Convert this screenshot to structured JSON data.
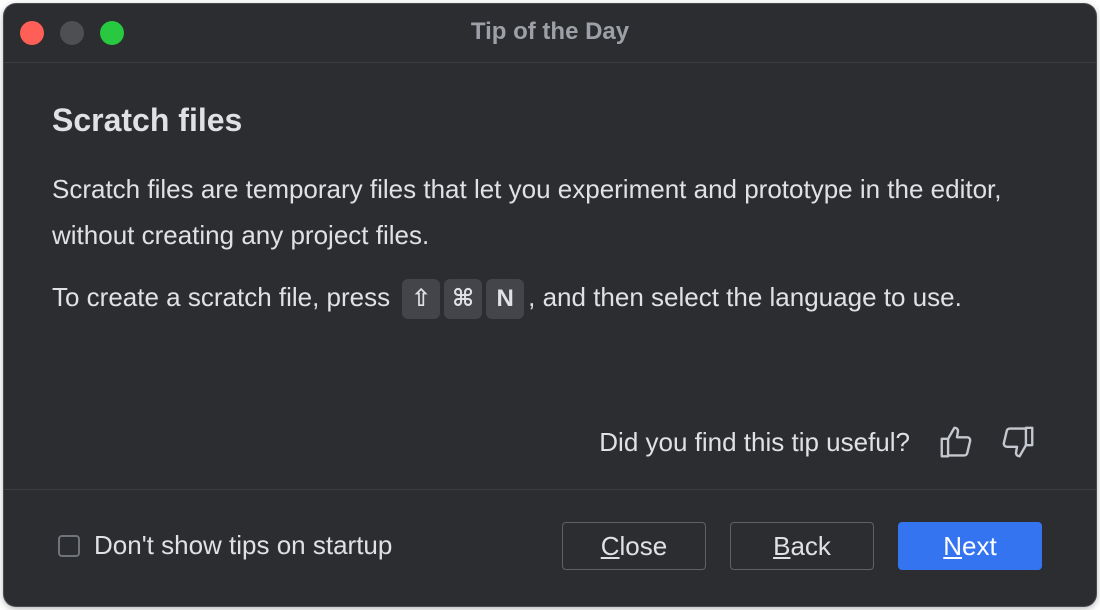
{
  "window": {
    "title": "Tip of the Day"
  },
  "tip": {
    "title": "Scratch files",
    "paragraph1": "Scratch files are temporary files that let you experiment and prototype in the editor, without creating any project files.",
    "paragraph2_before": "To create a scratch file, press",
    "keys": [
      "⇧",
      "⌘",
      "N"
    ],
    "paragraph2_after": ", and then select the language to use."
  },
  "feedback": {
    "question": "Did you find this tip useful?",
    "thumbs_up_icon": "thumbs-up-icon",
    "thumbs_down_icon": "thumbs-down-icon"
  },
  "footer": {
    "checkbox_label": "Don't show tips on startup",
    "checkbox_checked": false,
    "close_mnemonic": "C",
    "close_rest": "lose",
    "back_mnemonic": "B",
    "back_rest": "ack",
    "next_mnemonic": "N",
    "next_rest": "ext"
  },
  "colors": {
    "background": "#2b2d30",
    "text": "#dfe1e5",
    "primary_button": "#3574f0",
    "traffic_close": "#ff5f57",
    "traffic_min": "#4e4f52",
    "traffic_max": "#28c840"
  }
}
